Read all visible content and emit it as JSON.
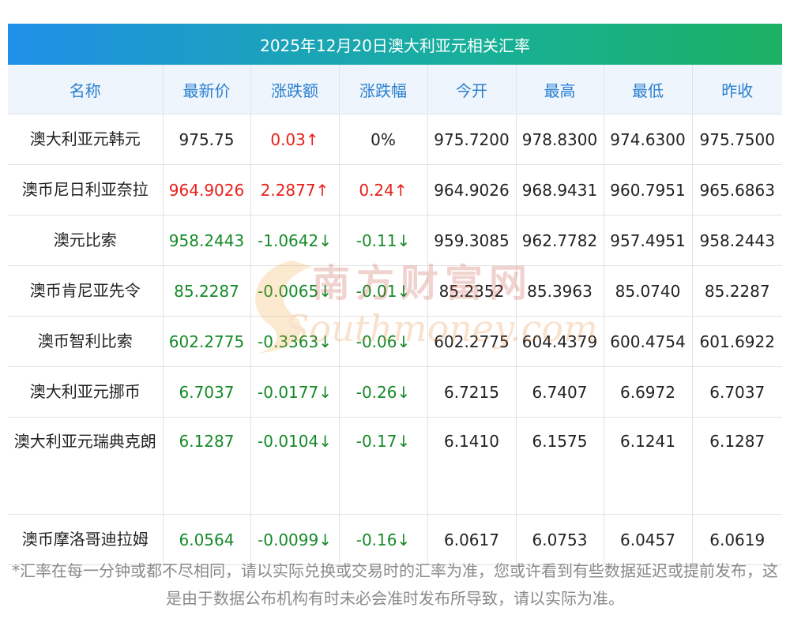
{
  "title": "2025年12月20日澳大利亚元相关汇率",
  "columns": [
    "名称",
    "最新价",
    "涨跌额",
    "涨跌幅",
    "今开",
    "最高",
    "最低",
    "昨收"
  ],
  "rows": [
    {
      "name": "澳大利亚元韩元",
      "latest": "975.75",
      "change": "0.03↑",
      "pct": "0%",
      "open": "975.7200",
      "high": "978.8300",
      "low": "974.6300",
      "prev": "975.7500",
      "latest_trend": "neutral",
      "change_trend": "up",
      "pct_trend": "neutral"
    },
    {
      "name": "澳币尼日利亚奈拉",
      "latest": "964.9026",
      "change": "2.2877↑",
      "pct": "0.24↑",
      "open": "964.9026",
      "high": "968.9431",
      "low": "960.7951",
      "prev": "965.6863",
      "latest_trend": "up",
      "change_trend": "up",
      "pct_trend": "up"
    },
    {
      "name": "澳元比索",
      "latest": "958.2443",
      "change": "-1.0642↓",
      "pct": "-0.11↓",
      "open": "959.3085",
      "high": "962.7782",
      "low": "957.4951",
      "prev": "958.2443",
      "latest_trend": "down",
      "change_trend": "down",
      "pct_trend": "down"
    },
    {
      "name": "澳币肯尼亚先令",
      "latest": "85.2287",
      "change": "-0.0065↓",
      "pct": "-0.01↓",
      "open": "85.2352",
      "high": "85.3963",
      "low": "85.0740",
      "prev": "85.2287",
      "latest_trend": "down",
      "change_trend": "down",
      "pct_trend": "down"
    },
    {
      "name": "澳币智利比索",
      "latest": "602.2775",
      "change": "-0.3363↓",
      "pct": "-0.06↓",
      "open": "602.2775",
      "high": "604.4379",
      "low": "600.4754",
      "prev": "601.6922",
      "latest_trend": "down",
      "change_trend": "down",
      "pct_trend": "down"
    },
    {
      "name": "澳大利亚元挪币",
      "latest": "6.7037",
      "change": "-0.0177↓",
      "pct": "-0.26↓",
      "open": "6.7215",
      "high": "6.7407",
      "low": "6.6972",
      "prev": "6.7037",
      "latest_trend": "down",
      "change_trend": "down",
      "pct_trend": "down"
    },
    {
      "name": "澳大利亚元瑞典克朗",
      "latest": "6.1287",
      "change": "-0.0104↓",
      "pct": "-0.17↓",
      "open": "6.1410",
      "high": "6.1575",
      "low": "6.1241",
      "prev": "6.1287",
      "latest_trend": "down",
      "change_trend": "down",
      "pct_trend": "down"
    },
    {
      "name": "澳币摩洛哥迪拉姆",
      "latest": "6.0564",
      "change": "-0.0099↓",
      "pct": "-0.16↓",
      "open": "6.0617",
      "high": "6.0753",
      "low": "6.0457",
      "prev": "6.0619",
      "latest_trend": "down",
      "change_trend": "down",
      "pct_trend": "down"
    }
  ],
  "watermark": {
    "cn": "南方财富网",
    "en": "Southmoney.com"
  },
  "footnote": "*汇率在每一分钟或都不尽相同，请以实际兑换或交易时的汇率为准，您或许看到有些数据延迟或提前发布，这是由于数据公布机构有时未必会准时发布所导致，请以实际为准。",
  "colors": {
    "up": "#e8201a",
    "down": "#168a28",
    "header_text": "#2a7fd0",
    "title_gradient_start": "#1f8fe8",
    "title_gradient_end": "#1bb061"
  }
}
